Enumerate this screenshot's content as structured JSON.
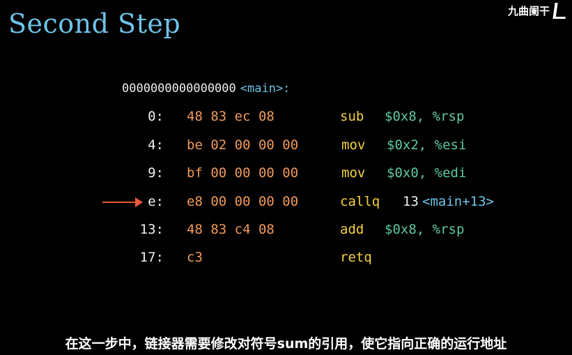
{
  "title": "Second Step",
  "watermark": "九曲阑干",
  "disasm": {
    "header_address": "0000000000000000",
    "header_label": "<main>:",
    "rows": [
      {
        "offset": "0:",
        "bytes": "48 83 ec 08",
        "mnemonic": "sub",
        "operands": "$0x8, %rsp"
      },
      {
        "offset": "4:",
        "bytes": "be 02 00 00 00",
        "mnemonic": "mov",
        "operands": "$0x2, %esi"
      },
      {
        "offset": "9:",
        "bytes": "bf 00 00 00 00",
        "mnemonic": "mov",
        "operands": "$0x0, %edi"
      },
      {
        "offset": "e:",
        "bytes": "e8 00 00 00 00",
        "mnemonic": "callq",
        "target_num": "13",
        "target_label": "<main+13>"
      },
      {
        "offset": "13:",
        "bytes": "48 83 c4 08",
        "mnemonic": "add",
        "operands": "$0x8, %rsp"
      },
      {
        "offset": "17:",
        "bytes": "c3",
        "mnemonic": "retq",
        "operands": ""
      }
    ]
  },
  "subtitle": "在这一步中，链接器需要修改对符号sum的引用，使它指向正确的运行地址",
  "colors": {
    "title": "#6fc3e8",
    "bytes": "#f19a5a",
    "mnemonic": "#f5d33f",
    "operands": "#5fc9a5",
    "arrow": "#ef5a3a"
  },
  "icons": {
    "pointer": "right-arrow-icon",
    "watermark_logo": "bracket-logo-icon"
  }
}
